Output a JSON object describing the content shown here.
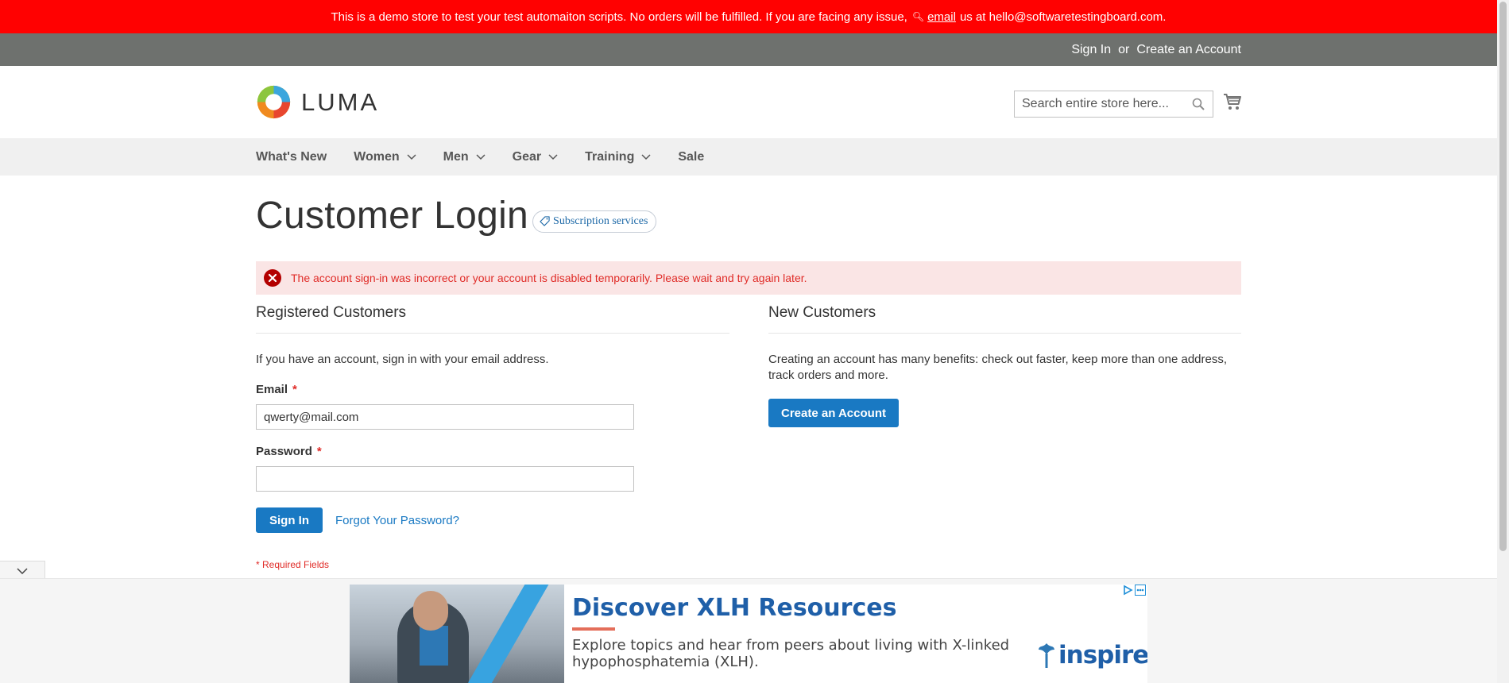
{
  "demo_notice": {
    "text_before": "This is a demo store to test your test automaiton scripts. No orders will be fulfilled. If you are facing any issue,",
    "icon": "magnifier-icon",
    "link_text": "email",
    "text_after": "us at hello@softwaretestingboard.com."
  },
  "top_links": {
    "sign_in": "Sign In",
    "or": "or",
    "create_account": "Create an Account"
  },
  "header": {
    "logo_text": "LUMA",
    "search_placeholder": "Search entire store here...",
    "search_icon": "search-icon",
    "cart_icon": "cart-icon"
  },
  "nav": {
    "items": [
      {
        "label": "What's New",
        "has_dropdown": false
      },
      {
        "label": "Women",
        "has_dropdown": true
      },
      {
        "label": "Men",
        "has_dropdown": true
      },
      {
        "label": "Gear",
        "has_dropdown": true
      },
      {
        "label": "Training",
        "has_dropdown": true
      },
      {
        "label": "Sale",
        "has_dropdown": false
      }
    ]
  },
  "page": {
    "title": "Customer Login",
    "subscription_badge": "Subscription services",
    "error_message": "The account sign-in was incorrect or your account is disabled temporarily. Please wait and try again later."
  },
  "registered": {
    "title": "Registered Customers",
    "intro": "If you have an account, sign in with your email address.",
    "email_label": "Email",
    "email_value": "qwerty@mail.com",
    "password_label": "Password",
    "password_value": "",
    "required_marker": "*",
    "sign_in_button": "Sign In",
    "forgot_link": "Forgot Your Password?",
    "required_note": "* Required Fields"
  },
  "new_customers": {
    "title": "New Customers",
    "text": "Creating an account has many benefits: check out faster, keep more than one address, track orders and more.",
    "create_button": "Create an Account"
  },
  "ad": {
    "headline": "Discover XLH Resources",
    "body": "Explore topics and hear from peers about living with X-linked hypophosphatemia (XLH).",
    "brand": "inspire"
  },
  "colors": {
    "demo_bar": "#ff0101",
    "top_links_bar": "#6e716e",
    "nav_bg": "#f0f0f0",
    "primary_button": "#1979c3",
    "error_bg": "#fae5e5",
    "error_text": "#e02b27"
  }
}
